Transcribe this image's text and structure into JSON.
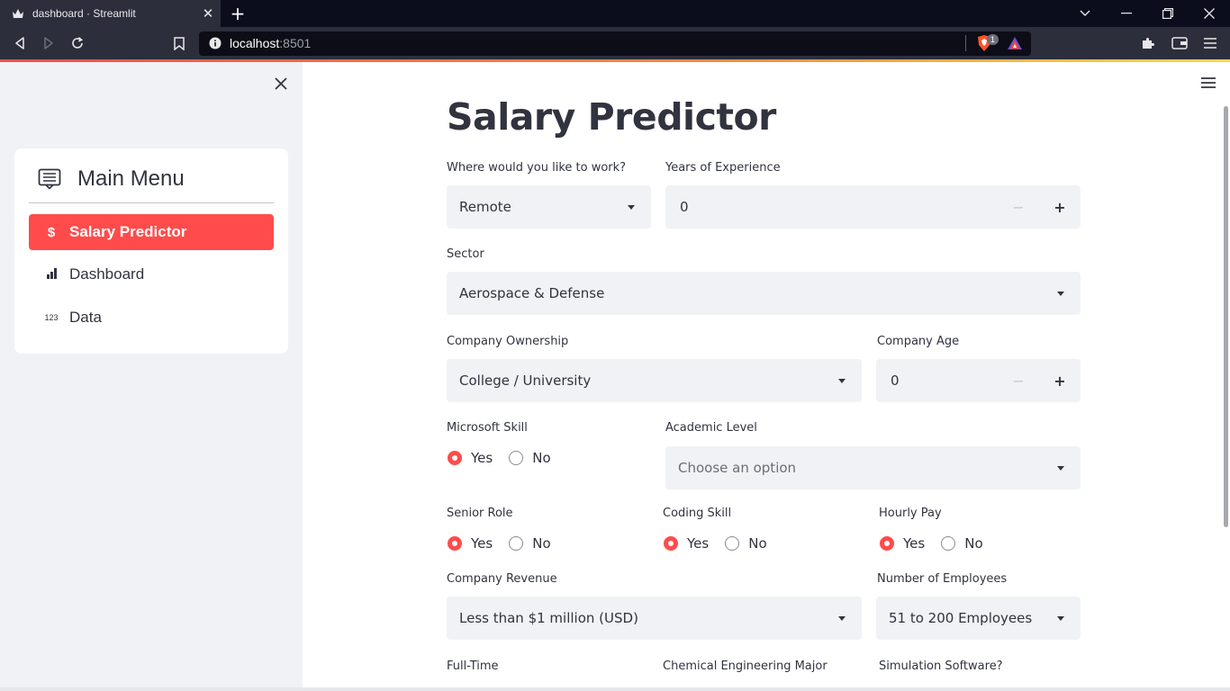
{
  "browser": {
    "tab_title": "dashboard · Streamlit",
    "url_host": "localhost",
    "url_port": ":8501",
    "brave_badge": "1"
  },
  "sidebar": {
    "menu_title": "Main Menu",
    "items": [
      {
        "label": "Salary Predictor",
        "icon": "dollar-icon",
        "glyph": "$",
        "active": true
      },
      {
        "label": "Dashboard",
        "icon": "bar-chart-icon",
        "glyph": "",
        "active": false
      },
      {
        "label": "Data",
        "icon": "numbers-123-icon",
        "glyph": "123",
        "active": false
      }
    ]
  },
  "main": {
    "title": "Salary Predictor",
    "work_location": {
      "label": "Where would you like to work?",
      "value": "Remote"
    },
    "experience": {
      "label": "Years of Experience",
      "value": "0",
      "minus": "−",
      "plus": "+"
    },
    "sector": {
      "label": "Sector",
      "value": "Aerospace & Defense"
    },
    "ownership": {
      "label": "Company Ownership",
      "value": "College / University"
    },
    "company_age": {
      "label": "Company Age",
      "value": "0",
      "minus": "−",
      "plus": "+"
    },
    "microsoft_skill": {
      "label": "Microsoft Skill",
      "options": [
        "Yes",
        "No"
      ],
      "selected": "Yes"
    },
    "academic_level": {
      "label": "Academic Level",
      "placeholder": "Choose an option"
    },
    "senior_role": {
      "label": "Senior Role",
      "options": [
        "Yes",
        "No"
      ],
      "selected": "Yes"
    },
    "coding_skill": {
      "label": "Coding Skill",
      "options": [
        "Yes",
        "No"
      ],
      "selected": "Yes"
    },
    "hourly_pay": {
      "label": "Hourly Pay",
      "options": [
        "Yes",
        "No"
      ],
      "selected": "Yes"
    },
    "revenue": {
      "label": "Company Revenue",
      "value": "Less than $1 million (USD)"
    },
    "employees": {
      "label": "Number of Employees",
      "value": "51 to 200 Employees"
    },
    "full_time": {
      "label": "Full-Time"
    },
    "chem_major": {
      "label": "Chemical Engineering Major"
    },
    "simulation": {
      "label": "Simulation Software?"
    }
  },
  "colors": {
    "accent": "#ff4b4b",
    "sidebar_bg": "#f0f2f6",
    "text": "#31333f"
  }
}
